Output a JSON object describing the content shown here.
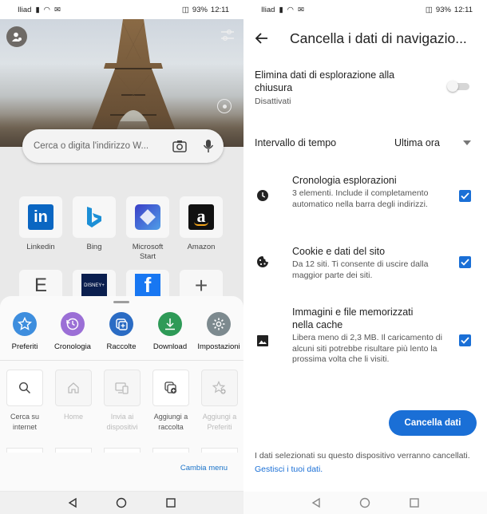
{
  "status": {
    "carrier": "Iliad",
    "battery": "93%",
    "time": "12:11"
  },
  "left": {
    "search": {
      "placeholder": "Cerca o digita l'indirizzo W..."
    },
    "tiles": [
      {
        "label": "Linkedin",
        "icon": "linkedin-logo"
      },
      {
        "label": "Bing",
        "icon": "bing-logo"
      },
      {
        "label": "Microsoft Start",
        "icon": "microsoft-start-logo"
      },
      {
        "label": "Amazon",
        "icon": "amazon-logo"
      }
    ],
    "tiles_row2": [
      {
        "label": "E",
        "icon": "letter-tile"
      },
      {
        "label": "DISNEY+",
        "icon": "disney-plus-logo"
      },
      {
        "label": "f",
        "icon": "facebook-logo"
      },
      {
        "label": "+",
        "icon": "add-icon"
      }
    ],
    "sheet": {
      "quick": [
        {
          "label": "Preferiti",
          "icon": "star-icon",
          "color": "#3e8ede"
        },
        {
          "label": "Cronologia",
          "icon": "history-icon",
          "color": "#9b6fd6"
        },
        {
          "label": "Raccolte",
          "icon": "collections-icon",
          "color": "#2b6cc4"
        },
        {
          "label": "Download",
          "icon": "download-icon",
          "color": "#2e9a57"
        },
        {
          "label": "Impostazioni",
          "icon": "gear-icon",
          "color": "#7d8a8f"
        }
      ],
      "actions": [
        {
          "label_line1": "Cerca su",
          "label_line2": "internet",
          "icon": "search-icon",
          "enabled": true
        },
        {
          "label_line1": "Home",
          "label_line2": "",
          "icon": "home-icon",
          "enabled": false
        },
        {
          "label_line1": "Invia ai",
          "label_line2": "dispositivi",
          "icon": "send-device-icon",
          "enabled": false
        },
        {
          "label_line1": "Aggiungi a",
          "label_line2": "raccolta",
          "icon": "add-collection-icon",
          "enabled": true
        },
        {
          "label_line1": "Aggiungi a",
          "label_line2": "Preferiti",
          "icon": "add-favorite-icon",
          "enabled": false
        }
      ],
      "cambia_menu": "Cambia menu"
    }
  },
  "right": {
    "title": "Cancella i dati di navigazio...",
    "delete_on_close": {
      "label": "Elimina dati di esplorazione alla chiusura",
      "state": "Disattivati",
      "enabled": false
    },
    "time_range": {
      "label": "Intervallo di tempo",
      "value": "Ultima ora"
    },
    "items": [
      {
        "title": "Cronologia esplorazioni",
        "desc": "3 elementi. Include il completamento automatico nella barra degli indirizzi.",
        "icon": "clock-icon",
        "checked": true
      },
      {
        "title": "Cookie e dati del sito",
        "desc": "Da 12 siti. Ti consente di uscire dalla maggior parte dei siti.",
        "icon": "cookie-icon",
        "checked": true
      },
      {
        "title": "Immagini e file memorizzati nella cache",
        "desc": "Libera meno di 2,3 MB. Il caricamento di alcuni siti potrebbe risultare più lento la prossima volta che li visiti.",
        "icon": "image-icon",
        "checked": true
      }
    ],
    "clear_button": "Cancella dati",
    "footer_text": "I dati selezionati su questo dispositivo verranno cancellati.",
    "footer_link": "Gestisci i tuoi dati."
  }
}
